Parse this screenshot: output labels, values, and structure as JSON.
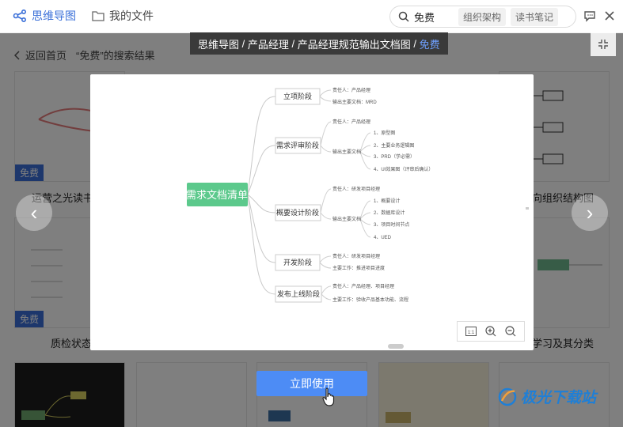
{
  "header": {
    "brand": "思维导图",
    "my_files": "我的文件",
    "search_value": "免费",
    "chips": [
      "组织架构",
      "读书笔记"
    ]
  },
  "back": {
    "label": "返回首页",
    "result_title": "“免费”的搜索结果"
  },
  "cards": {
    "badge": "免费",
    "row1_titles": [
      "运营之光读书",
      "向组织结构图"
    ],
    "row2_titles": [
      "质检状态",
      "学习及其分类"
    ]
  },
  "preview": {
    "breadcrumb": [
      "思维导图",
      "产品经理",
      "产品经理规范输出文档图"
    ],
    "breadcrumb_current": "免费",
    "root": "需求文档清单",
    "branches": [
      {
        "title": "立项阶段",
        "lines": [
          "责任人：产品经理",
          "输出主要文档：MRD"
        ]
      },
      {
        "title": "需求评审阶段",
        "lines": [
          "责任人：产品经理",
          "输出主要文档"
        ],
        "items": [
          "1、原型图",
          "2、主要业务逻辑图",
          "3、PRD（学必需）",
          "4、UI效果图（评审后确认）"
        ]
      },
      {
        "title": "概要设计阶段",
        "lines": [
          "责任人：研发项目经理",
          "输出主要文档"
        ],
        "items": [
          "1、概要设计",
          "2、数据库设计",
          "3、项目时间节点",
          "4、UED"
        ]
      },
      {
        "title": "开发阶段",
        "lines": [
          "责任人：研发项目经理",
          "主要工作：推进项目进度"
        ]
      },
      {
        "title": "发布上线阶段",
        "lines": [
          "责任人：产品经理、项目经理",
          "主要工作：验收产品基本功能、流程"
        ]
      }
    ],
    "zoom_buttons": [
      "1:1",
      "zoom-in",
      "zoom-out"
    ]
  },
  "use_button": "立即使用",
  "watermark": "极光下载站",
  "colors": {
    "accent": "#3a6fd8",
    "root": "#5cc98c",
    "button": "#4d8cf5"
  }
}
